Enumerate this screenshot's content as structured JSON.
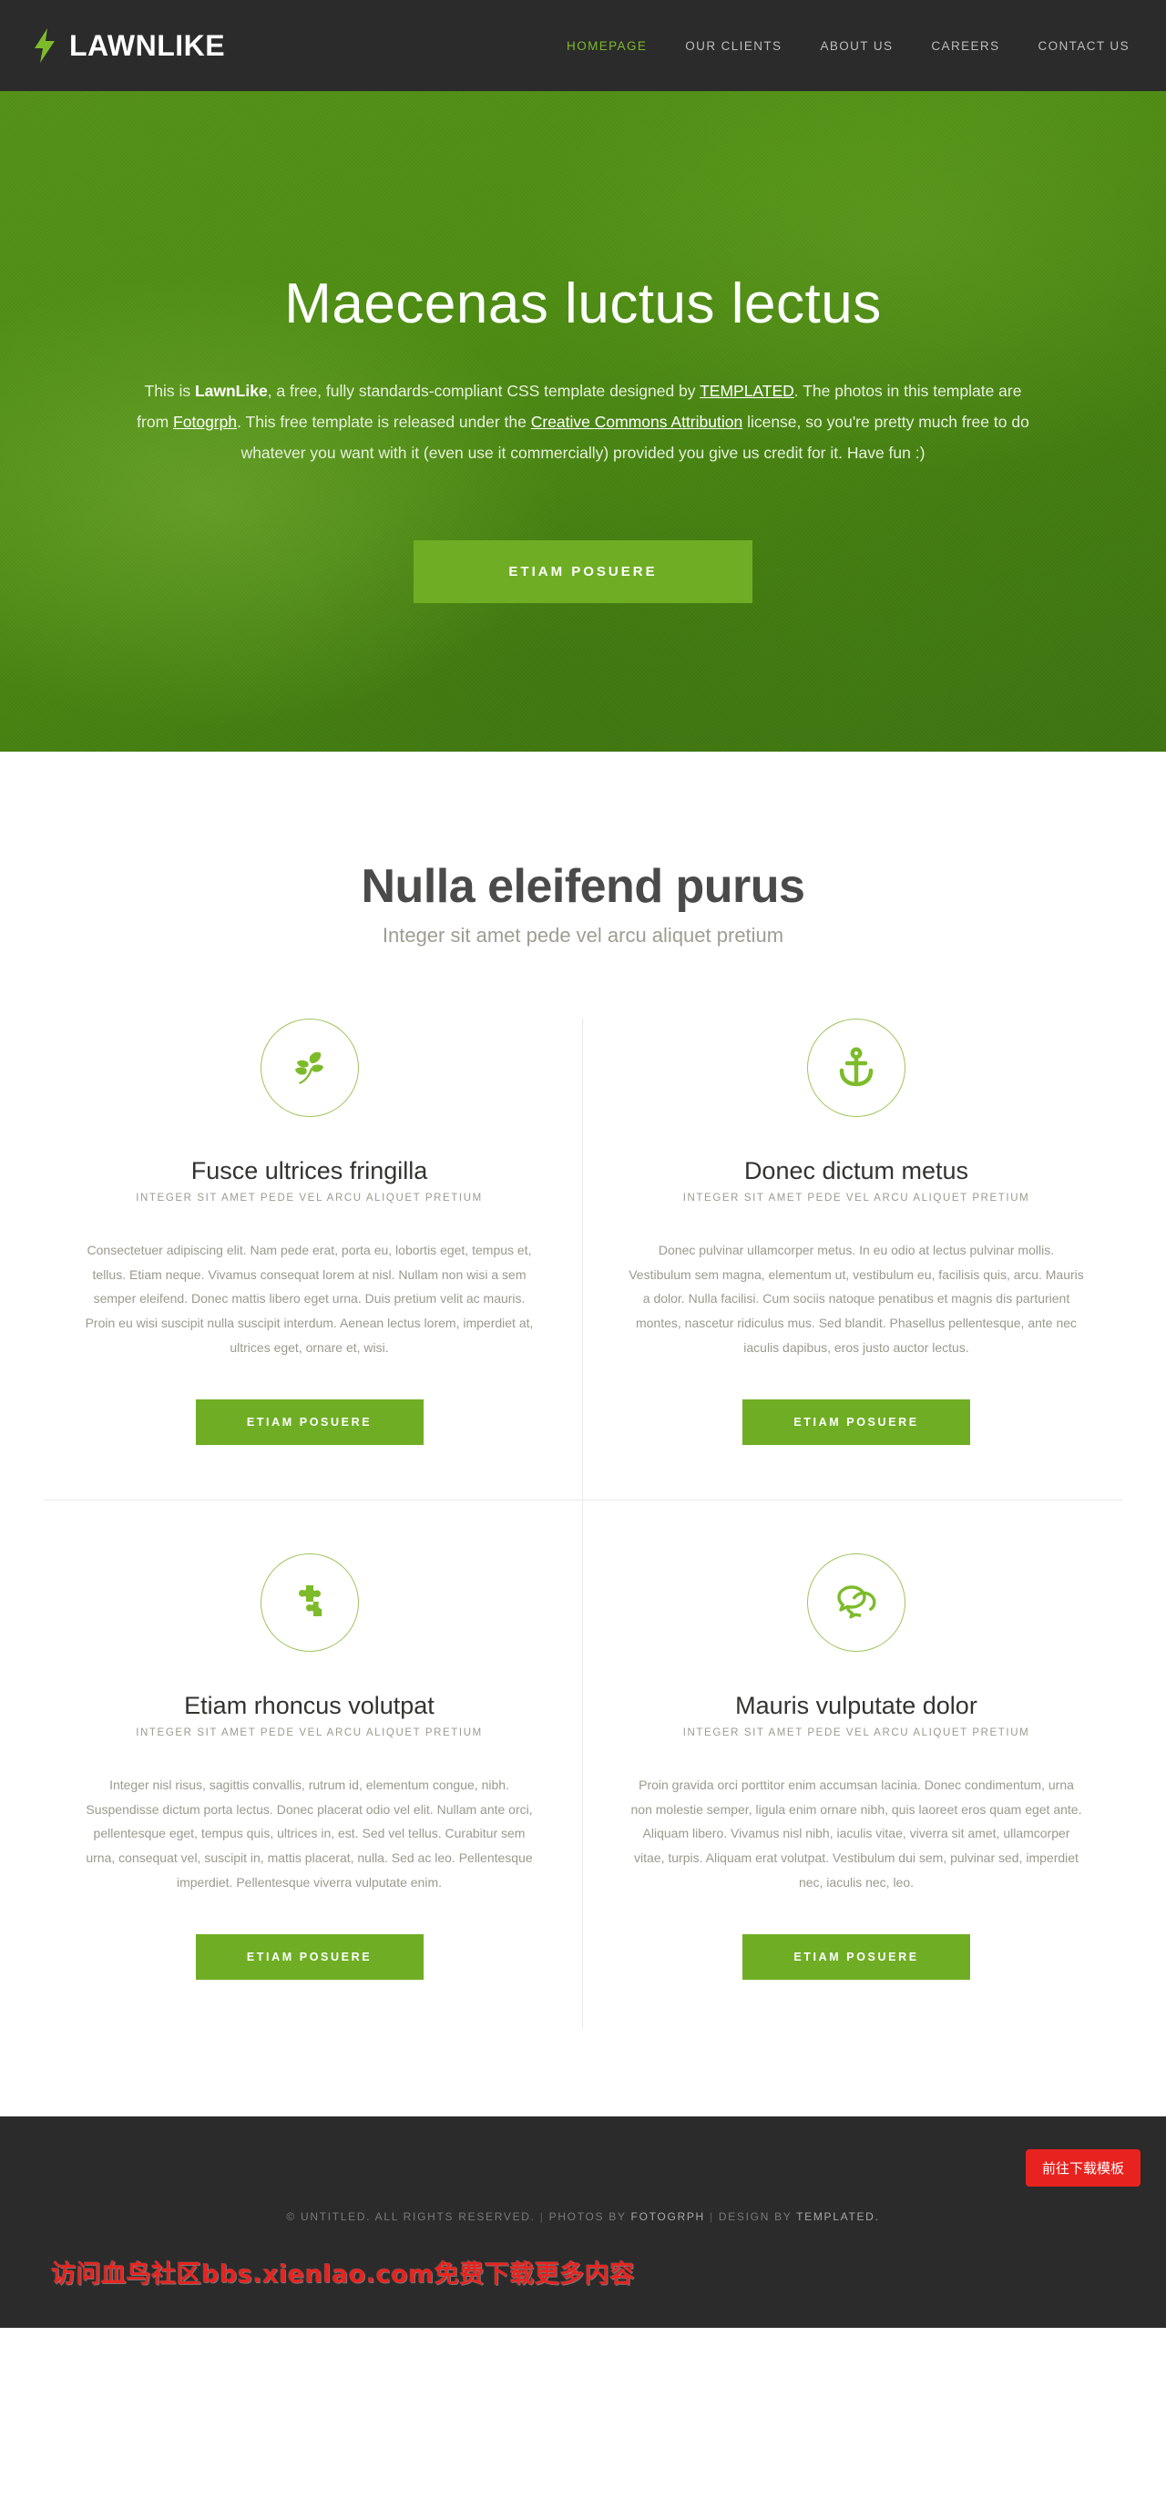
{
  "header": {
    "logo": {
      "icon": "lightning-bolt-icon",
      "text": "LAWNLIKE"
    },
    "nav": [
      {
        "label": "HOMEPAGE",
        "active": true
      },
      {
        "label": "OUR CLIENTS",
        "active": false
      },
      {
        "label": "ABOUT US",
        "active": false
      },
      {
        "label": "CAREERS",
        "active": false
      },
      {
        "label": "CONTACT US",
        "active": false
      }
    ]
  },
  "hero": {
    "title": "Maecenas luctus lectus",
    "copy": {
      "part1": "This is ",
      "brand": "LawnLike",
      "part2": ", a free, fully standards-compliant CSS template designed by ",
      "link1": "TEMPLATED",
      "part3": ". The photos in this template are from ",
      "link2": "Fotogrph",
      "part4": ". This free template is released under the ",
      "link3": "Creative Commons Attribution",
      "part5": " license, so you're pretty much free to do whatever you want with it (even use it commercially) provided you give us credit for it. Have fun :)"
    },
    "button": "ETIAM POSUERE"
  },
  "main": {
    "title": "Nulla eleifend purus",
    "subtitle": "Integer sit amet pede vel arcu aliquet pretium",
    "boxes": [
      {
        "icon": "leaf-icon",
        "title": "Fusce ultrices fringilla",
        "subtitle": "INTEGER SIT AMET PEDE VEL ARCU ALIQUET PRETIUM",
        "body": "Consectetuer adipiscing elit. Nam pede erat, porta eu, lobortis eget, tempus et, tellus. Etiam neque. Vivamus consequat lorem at nisl. Nullam non wisi a sem semper eleifend. Donec mattis libero eget urna. Duis pretium velit ac mauris. Proin eu wisi suscipit nulla suscipit interdum. Aenean lectus lorem, imperdiet at, ultrices eget, ornare et, wisi.",
        "button": "ETIAM POSUERE"
      },
      {
        "icon": "anchor-icon",
        "title": "Donec dictum metus",
        "subtitle": "INTEGER SIT AMET PEDE VEL ARCU ALIQUET PRETIUM",
        "body": "Donec pulvinar ullamcorper metus. In eu odio at lectus pulvinar mollis. Vestibulum sem magna, elementum ut, vestibulum eu, facilisis quis, arcu. Mauris a dolor. Nulla facilisi. Cum sociis natoque penatibus et magnis dis parturient montes, nascetur ridiculus mus. Sed blandit. Phasellus pellentesque, ante nec iaculis dapibus, eros justo auctor lectus.",
        "button": "ETIAM POSUERE"
      },
      {
        "icon": "puzzle-icon",
        "title": "Etiam rhoncus volutpat",
        "subtitle": "INTEGER SIT AMET PEDE VEL ARCU ALIQUET PRETIUM",
        "body": "Integer nisl risus, sagittis convallis, rutrum id, elementum congue, nibh. Suspendisse dictum porta lectus. Donec placerat odio vel elit. Nullam ante orci, pellentesque eget, tempus quis, ultrices in, est. Sed vel tellus. Curabitur sem urna, consequat vel, suscipit in, mattis placerat, nulla. Sed ac leo. Pellentesque imperdiet. Pellentesque viverra vulputate enim.",
        "button": "ETIAM POSUERE"
      },
      {
        "icon": "chat-bubbles-icon",
        "title": "Mauris vulputate dolor",
        "subtitle": "INTEGER SIT AMET PEDE VEL ARCU ALIQUET PRETIUM",
        "body": "Proin gravida orci porttitor enim accumsan lacinia. Donec condimentum, urna non molestie semper, ligula enim ornare nibh, quis laoreet eros quam eget ante. Aliquam libero. Vivamus nisl nibh, iaculis vitae, viverra sit amet, ullamcorper vitae, turpis. Aliquam erat volutpat. Vestibulum dui sem, pulvinar sed, imperdiet nec, iaculis nec, leo.",
        "button": "ETIAM POSUERE"
      }
    ]
  },
  "footer": {
    "copyright": "© UNTITLED. ALL RIGHTS RESERVED.",
    "sep1": "|",
    "photos_prefix": "PHOTOS BY",
    "photos_by": "FOTOGRPH",
    "sep2": "|",
    "design_prefix": "DESIGN BY",
    "design_by": "TEMPLATED."
  },
  "watermark": {
    "text": "访问血鸟社区bbs.xienlao.com免费下载更多内容",
    "button": "前往下载模板"
  },
  "colors": {
    "brand_green": "#7dbb2b",
    "button_green": "#6fae24",
    "hero_green": "#4e8d13",
    "dark": "#2b2b2b",
    "watermark_red": "#e8231f"
  }
}
